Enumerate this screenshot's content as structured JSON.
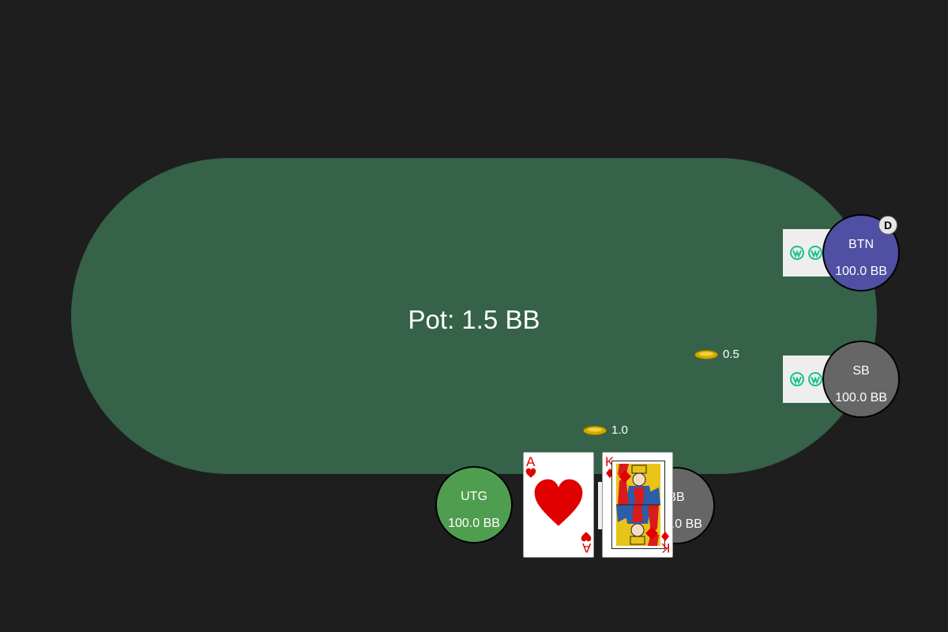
{
  "pot": {
    "label": "Pot: 1.5 BB"
  },
  "seats": {
    "btn": {
      "position": "BTN",
      "stack": "100.0 BB",
      "color": "#4f4fa3"
    },
    "sb": {
      "position": "SB",
      "stack": "100.0 BB",
      "color": "#666666"
    },
    "bb": {
      "position": "BB",
      "stack": "100.0 BB",
      "color": "#666666"
    },
    "utg": {
      "position": "UTG",
      "stack": "100.0 BB",
      "color": "#4f9e4f"
    }
  },
  "dealer_button": {
    "label": "D"
  },
  "bets": {
    "sb": {
      "amount": "0.5"
    },
    "bb": {
      "amount": "1.0"
    }
  },
  "hero_cards": [
    {
      "rank": "A",
      "suit": "hearts",
      "color": "#e00000"
    },
    {
      "rank": "K",
      "suit": "diamonds",
      "color": "#e00000"
    }
  ],
  "colors": {
    "felt": "#356249",
    "background": "#1e1e1e",
    "chip": "#d4aa00"
  },
  "icons": {
    "card_back_logo": "ww-logo-icon",
    "chip": "chip-icon"
  }
}
